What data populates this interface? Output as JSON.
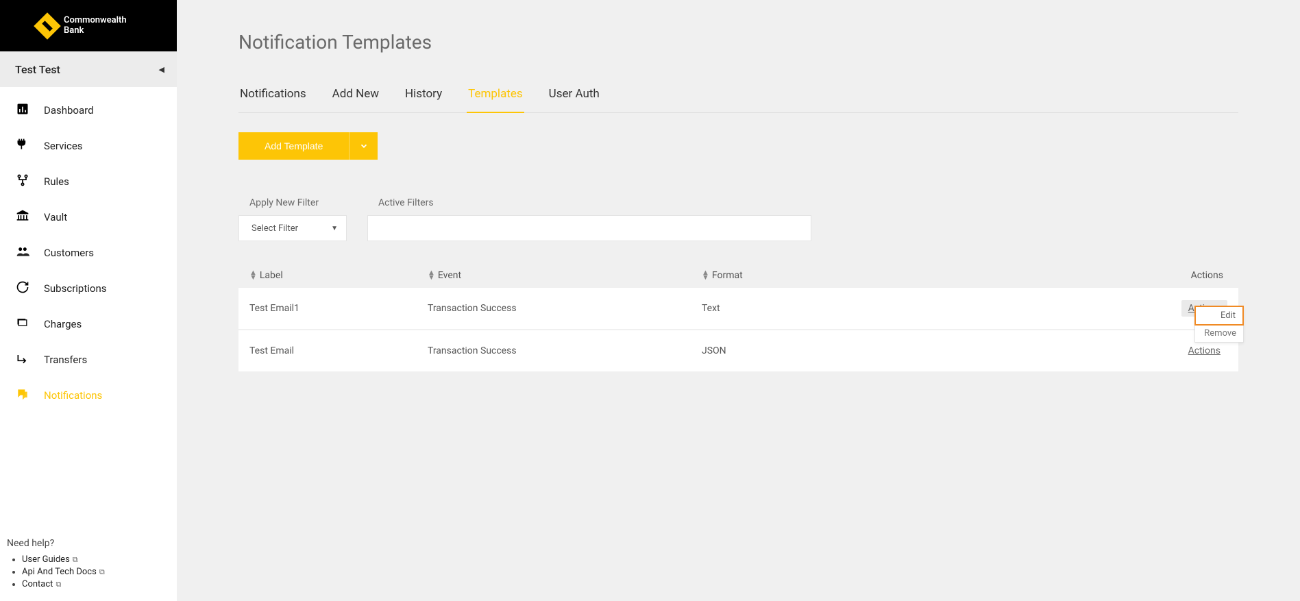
{
  "brand": {
    "line1": "Commonwealth",
    "line2": "Bank"
  },
  "user_name": "Test Test",
  "nav": [
    {
      "label": "Dashboard",
      "icon": "dashboard-icon"
    },
    {
      "label": "Services",
      "icon": "services-icon"
    },
    {
      "label": "Rules",
      "icon": "rules-icon"
    },
    {
      "label": "Vault",
      "icon": "vault-icon"
    },
    {
      "label": "Customers",
      "icon": "customers-icon"
    },
    {
      "label": "Subscriptions",
      "icon": "subscriptions-icon"
    },
    {
      "label": "Charges",
      "icon": "charges-icon"
    },
    {
      "label": "Transfers",
      "icon": "transfers-icon"
    },
    {
      "label": "Notifications",
      "icon": "notifications-icon",
      "active": true
    }
  ],
  "help": {
    "title": "Need help?",
    "links": [
      {
        "label": "User Guides"
      },
      {
        "label": "Api And Tech Docs"
      },
      {
        "label": "Contact"
      }
    ]
  },
  "page_title": "Notification Templates",
  "tabs": [
    {
      "label": "Notifications"
    },
    {
      "label": "Add New"
    },
    {
      "label": "History"
    },
    {
      "label": "Templates",
      "active": true
    },
    {
      "label": "User Auth"
    }
  ],
  "add_button": "Add Template",
  "filters": {
    "apply_label": "Apply New Filter",
    "select_placeholder": "Select Filter",
    "active_label": "Active Filters"
  },
  "columns": {
    "label": "Label",
    "event": "Event",
    "format": "Format",
    "actions": "Actions"
  },
  "rows": [
    {
      "label": "Test Email1",
      "event": "Transaction Success",
      "format": "Text",
      "actions_open": true
    },
    {
      "label": "Test Email",
      "event": "Transaction Success",
      "format": "JSON",
      "actions_open": false
    }
  ],
  "row_action_trigger": "Actions",
  "dropdown": {
    "edit": "Edit",
    "remove": "Remove"
  }
}
